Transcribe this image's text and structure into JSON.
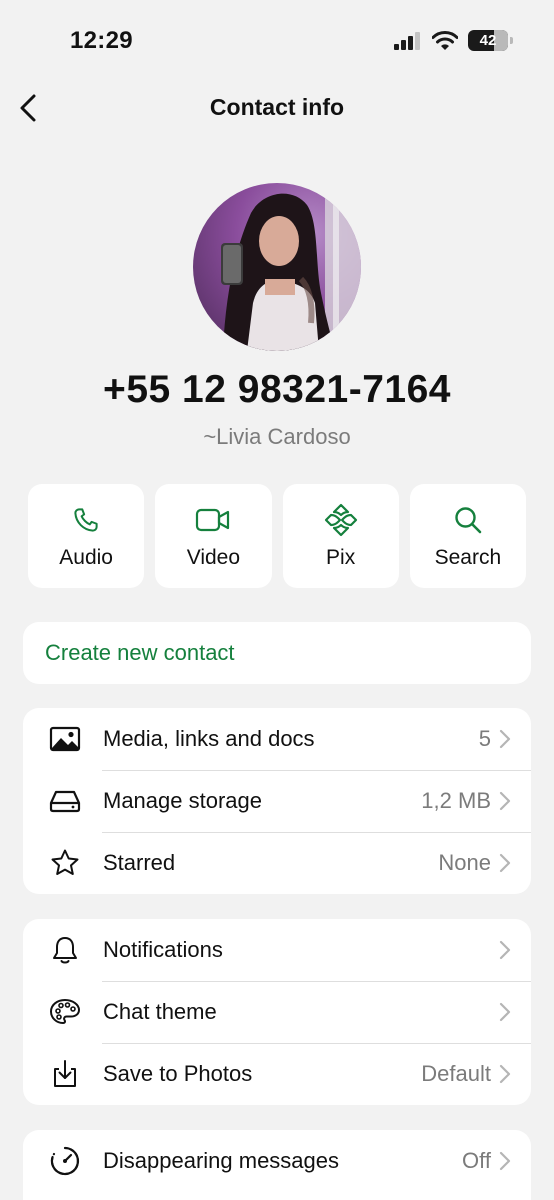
{
  "status": {
    "time": "12:29",
    "battery": "42"
  },
  "nav": {
    "title": "Contact info"
  },
  "contact": {
    "phone": "+55 12 98321-7164",
    "name": "~Livia Cardoso"
  },
  "actions": [
    {
      "label": "Audio",
      "icon": "phone-icon"
    },
    {
      "label": "Video",
      "icon": "video-icon"
    },
    {
      "label": "Pix",
      "icon": "pix-icon"
    },
    {
      "label": "Search",
      "icon": "search-icon"
    }
  ],
  "create_contact": "Create new contact",
  "media_section": [
    {
      "label": "Media, links and docs",
      "value": "5",
      "icon": "image-icon"
    },
    {
      "label": "Manage storage",
      "value": "1,2 MB",
      "icon": "storage-icon"
    },
    {
      "label": "Starred",
      "value": "None",
      "icon": "star-icon"
    }
  ],
  "settings_section": [
    {
      "label": "Notifications",
      "value": "",
      "icon": "bell-icon"
    },
    {
      "label": "Chat theme",
      "value": "",
      "icon": "palette-icon"
    },
    {
      "label": "Save to Photos",
      "value": "Default",
      "icon": "download-icon"
    }
  ],
  "disappear_section": [
    {
      "label": "Disappearing messages",
      "value": "Off",
      "icon": "timer-icon"
    }
  ],
  "colors": {
    "accent": "#15803d",
    "background": "#f2f2f2",
    "card": "#ffffff",
    "secondary_text": "#7b7b7b"
  }
}
